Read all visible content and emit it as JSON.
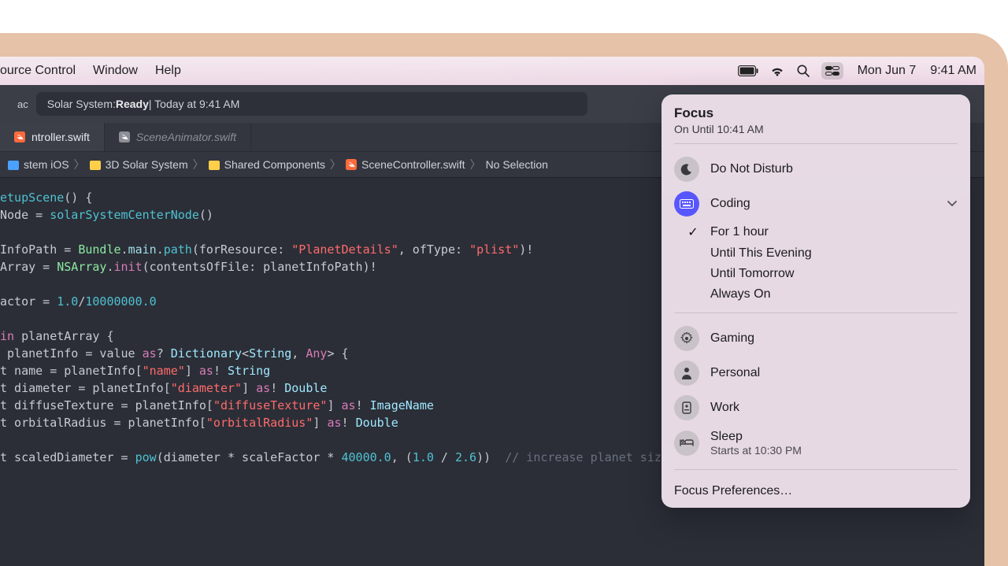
{
  "menubar": {
    "items": [
      "ource Control",
      "Window",
      "Help"
    ],
    "date": "Mon Jun 7",
    "time": "9:41 AM"
  },
  "toolbar": {
    "left_chip": "ac",
    "status_prefix": "Solar System: ",
    "status_bold": "Ready",
    "status_suffix": " | Today at 9:41 AM"
  },
  "tabs": [
    {
      "label": "ntroller.swift",
      "active": true,
      "dim": false
    },
    {
      "label": "SceneAnimator.swift",
      "active": false,
      "dim": true
    }
  ],
  "crumbs": {
    "c0": "stem iOS",
    "c1": "3D Solar System",
    "c2": "Shared Components",
    "c3": "SceneController.swift",
    "c4": "No Selection"
  },
  "code": {
    "l1a": "etupScene",
    "l1b": "() {",
    "l2a": "Node = ",
    "l2b": "solarSystemCenterNode",
    "l2c": "()",
    "l4a": "InfoPath = ",
    "l4b": "Bundle",
    "l4c": ".",
    "l4d": "main",
    "l4e": ".",
    "l4f": "path",
    "l4g": "(forResource: ",
    "l4h": "\"PlanetDetails\"",
    "l4i": ", ofType: ",
    "l4j": "\"plist\"",
    "l4k": ")!",
    "l5a": "Array = ",
    "l5b": "NSArray",
    "l5c": ".",
    "l5d": "init",
    "l5e": "(contentsOfFile: planetInfoPath)!",
    "l7a": "actor = ",
    "l7b": "1.0",
    "l7c": "/",
    "l7d": "10000000.0",
    "l9a": "in",
    "l9b": " planetArray {",
    "l10a": " planetInfo = value ",
    "l10b": "as",
    "l10c": "? ",
    "l10d": "Dictionary",
    "l10e": "<",
    "l10f": "String",
    "l10g": ", ",
    "l10h": "Any",
    "l10i": "> {",
    "l11a": "t name = planetInfo[",
    "l11b": "\"name\"",
    "l11c": "] ",
    "l11d": "as",
    "l11e": "! ",
    "l11f": "String",
    "l12a": "t diameter = planetInfo[",
    "l12b": "\"diameter\"",
    "l12c": "] ",
    "l12d": "as",
    "l12e": "! ",
    "l12f": "Double",
    "l13a": "t diffuseTexture = planetInfo[",
    "l13b": "\"diffuseTexture\"",
    "l13c": "] ",
    "l13d": "as",
    "l13e": "! ",
    "l13f": "ImageName",
    "l14a": "t orbitalRadius = planetInfo[",
    "l14b": "\"orbitalRadius\"",
    "l14c": "] ",
    "l14d": "as",
    "l14e": "! ",
    "l14f": "Double",
    "l16a": "t scaledDiameter = ",
    "l16b": "pow",
    "l16c": "(diameter * scaleFactor * ",
    "l16d": "40000.0",
    "l16e": ", (",
    "l16f": "1.0",
    "l16g": " / ",
    "l16h": "2.6",
    "l16i": "))  ",
    "l16j": "// increase planet size"
  },
  "focus": {
    "title": "Focus",
    "subtitle": "On Until 10:41 AM",
    "dnd": "Do Not Disturb",
    "coding": "Coding",
    "opt1": "For 1 hour",
    "opt2": "Until This Evening",
    "opt3": "Until Tomorrow",
    "opt4": "Always On",
    "gaming": "Gaming",
    "personal": "Personal",
    "work": "Work",
    "sleep": "Sleep",
    "sleep_sub": "Starts at 10:30 PM",
    "prefs": "Focus Preferences…"
  }
}
